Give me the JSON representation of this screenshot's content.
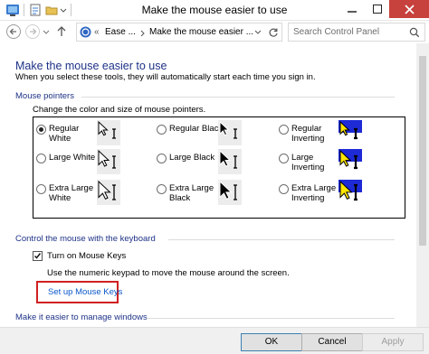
{
  "window": {
    "title": "Make the mouse easier to use",
    "controls": [
      "minimize-icon",
      "maximize-icon",
      "close-icon"
    ]
  },
  "address": {
    "overflow": "«",
    "crumbs": [
      "Ease ...",
      "Make the mouse easier ..."
    ],
    "search_placeholder": "Search Control Panel"
  },
  "page": {
    "heading": "Make the mouse easier to use",
    "intro": "When you select these tools, they will automatically start each time you sign in."
  },
  "pointers": {
    "section_title": "Mouse pointers",
    "instruction": "Change the color and size of mouse pointers.",
    "options": [
      {
        "label_lines": [
          "Regular",
          "White"
        ],
        "selected": true,
        "preview": "white-regular"
      },
      {
        "label_lines": [
          "Regular Black"
        ],
        "selected": false,
        "preview": "black-regular"
      },
      {
        "label_lines": [
          "Regular",
          "Inverting"
        ],
        "selected": false,
        "preview": "invert-regular"
      },
      {
        "label_lines": [
          "Large White"
        ],
        "selected": false,
        "preview": "white-large"
      },
      {
        "label_lines": [
          "Large Black"
        ],
        "selected": false,
        "preview": "black-large"
      },
      {
        "label_lines": [
          "Large",
          "Inverting"
        ],
        "selected": false,
        "preview": "invert-large"
      },
      {
        "label_lines": [
          "Extra Large",
          "White"
        ],
        "selected": false,
        "preview": "white-xl"
      },
      {
        "label_lines": [
          "Extra Large",
          "Black"
        ],
        "selected": false,
        "preview": "black-xl"
      },
      {
        "label_lines": [
          "Extra Large",
          "Inverting"
        ],
        "selected": false,
        "preview": "invert-xl"
      }
    ]
  },
  "keyboard": {
    "section_title": "Control the mouse with the keyboard",
    "mouse_keys_label": "Turn on Mouse Keys",
    "mouse_keys_checked": true,
    "mouse_keys_hint": "Use the numeric keypad to move the mouse around the screen.",
    "setup_link": "Set up Mouse Keys"
  },
  "windows": {
    "section_title": "Make it easier to manage windows"
  },
  "buttons": {
    "ok": "OK",
    "cancel": "Cancel",
    "apply": "Apply"
  },
  "colors": {
    "heading": "#1e3287",
    "link": "#0b57c9",
    "close_button": "#c7423d",
    "highlight_box": "#d02020",
    "invert_preview": "#1d2ad6"
  }
}
